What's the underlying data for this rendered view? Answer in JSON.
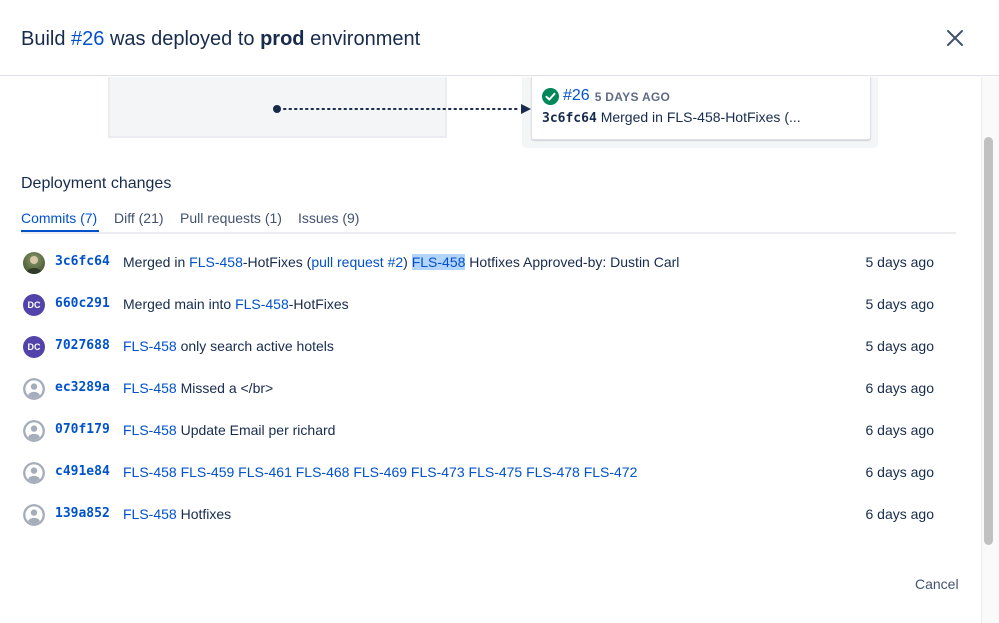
{
  "modal": {
    "title_prefix": "Build",
    "build_link": "#26",
    "title_mid": "was deployed to",
    "environment": "prod",
    "title_suffix": "environment"
  },
  "deployment_card": {
    "build": "#26",
    "ago": "5 DAYS AGO",
    "hash": "3c6fc64",
    "message": "Merged in FLS-458-HotFixes (..."
  },
  "section_title": "Deployment changes",
  "tabs": [
    {
      "label": "Commits (7)",
      "active": true
    },
    {
      "label": "Diff (21)",
      "active": false
    },
    {
      "label": "Pull requests (1)",
      "active": false
    },
    {
      "label": "Issues (9)",
      "active": false
    }
  ],
  "commits": [
    {
      "avatar": "photo",
      "hash": "3c6fc64",
      "parts": [
        "Merged in ",
        "FLS-458",
        "-HotFixes (",
        "pull request #2",
        ") ",
        "FLS-458",
        " Hotfixes Approved-by: Dustin Carl"
      ],
      "date": "5 days ago"
    },
    {
      "avatar": "DC",
      "hash": "660c291",
      "parts": [
        "Merged main into ",
        "FLS-458",
        "-HotFixes"
      ],
      "date": "5 days ago"
    },
    {
      "avatar": "DC",
      "hash": "7027688",
      "parts": [
        "FLS-458",
        " only search active hotels"
      ],
      "date": "5 days ago"
    },
    {
      "avatar": "default",
      "hash": "ec3289a",
      "parts": [
        "FLS-458",
        " Missed a </br>"
      ],
      "date": "6 days ago"
    },
    {
      "avatar": "default",
      "hash": "070f179",
      "parts": [
        "FLS-458",
        " Update Email per richard"
      ],
      "date": "6 days ago"
    },
    {
      "avatar": "default",
      "hash": "c491e84",
      "parts": [
        "FLS-458 FLS-459 FLS-461 FLS-468 FLS-469 FLS-473 FLS-475 FLS-478 FLS-472"
      ],
      "date": "6 days ago"
    },
    {
      "avatar": "default",
      "hash": "139a852",
      "parts": [
        "FLS-458",
        " Hotfixes"
      ],
      "date": "6 days ago"
    }
  ],
  "footer": {
    "cancel_label": "Cancel"
  },
  "colors": {
    "link": "#0052cc",
    "text": "#172b4d",
    "success": "#00875a",
    "avatar_purple": "#5243aa"
  }
}
